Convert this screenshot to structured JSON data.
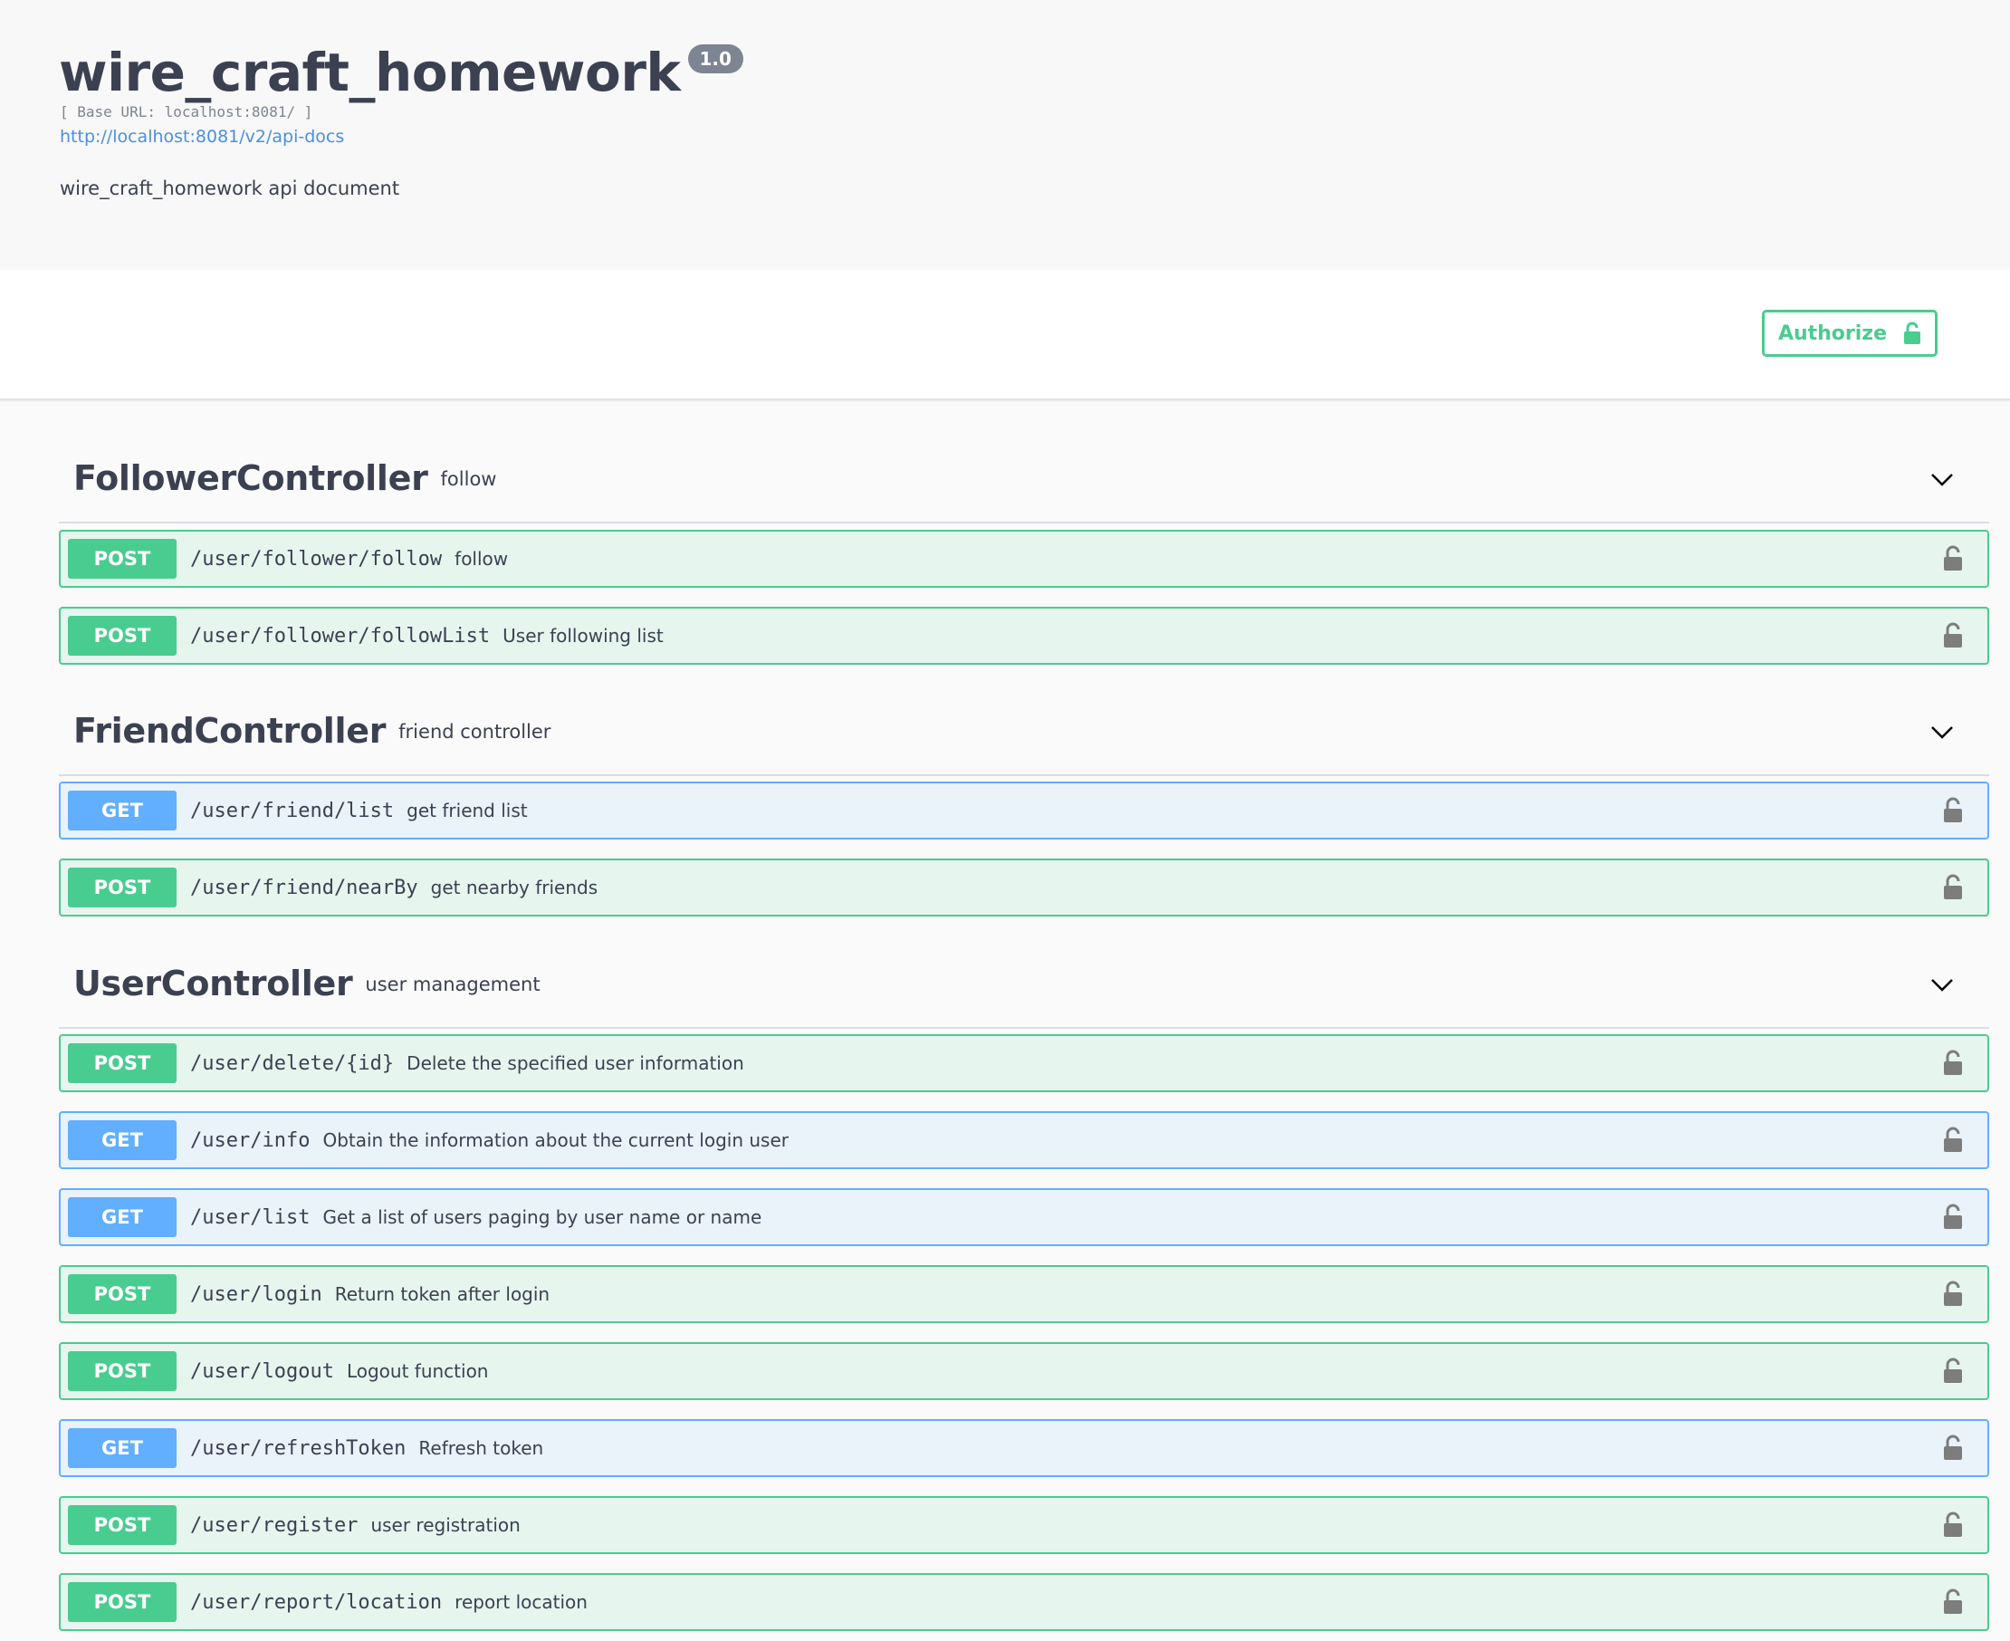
{
  "info": {
    "title": "wire_craft_homework",
    "version": "1.0",
    "base_url": "[ Base URL: localhost:8081/ ]",
    "api_docs_link": "http://localhost:8081/v2/api-docs",
    "description": "wire_craft_homework api document"
  },
  "scheme": {
    "authorize_label": "Authorize"
  },
  "colors": {
    "post": "#49cc90",
    "get": "#61affe",
    "link": "#4990e2",
    "text": "#3b4151"
  },
  "icons": {
    "lock": "unlocked-padlock-icon",
    "expand": "chevron-down-icon"
  },
  "tags": [
    {
      "name": "FollowerController",
      "description": "follow",
      "operations": [
        {
          "method": "POST",
          "path": "/user/follower/follow",
          "summary": "follow"
        },
        {
          "method": "POST",
          "path": "/user/follower/followList",
          "summary": "User following list"
        }
      ]
    },
    {
      "name": "FriendController",
      "description": "friend controller",
      "operations": [
        {
          "method": "GET",
          "path": "/user/friend/list",
          "summary": "get friend list"
        },
        {
          "method": "POST",
          "path": "/user/friend/nearBy",
          "summary": "get nearby friends"
        }
      ]
    },
    {
      "name": "UserController",
      "description": "user management",
      "operations": [
        {
          "method": "POST",
          "path": "/user/delete/{id}",
          "summary": "Delete the specified user information"
        },
        {
          "method": "GET",
          "path": "/user/info",
          "summary": "Obtain the information about the current login user"
        },
        {
          "method": "GET",
          "path": "/user/list",
          "summary": "Get a list of users paging by user name or name"
        },
        {
          "method": "POST",
          "path": "/user/login",
          "summary": "Return token after login"
        },
        {
          "method": "POST",
          "path": "/user/logout",
          "summary": "Logout function"
        },
        {
          "method": "GET",
          "path": "/user/refreshToken",
          "summary": "Refresh token"
        },
        {
          "method": "POST",
          "path": "/user/register",
          "summary": "user registration"
        },
        {
          "method": "POST",
          "path": "/user/report/location",
          "summary": "report location"
        }
      ]
    }
  ]
}
